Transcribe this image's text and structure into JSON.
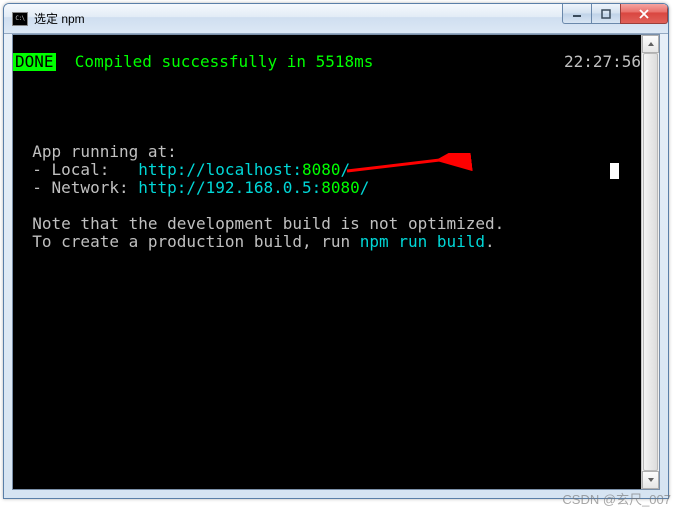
{
  "window": {
    "title": "选定 npm"
  },
  "terminal": {
    "status": {
      "badge": "DONE",
      "message": "Compiled successfully in 5518ms",
      "time": "22:27:56"
    },
    "app_running": "App running at:",
    "local_label": "- Local:   ",
    "local_url_host": "http://localhost:",
    "local_url_port": "8080",
    "local_url_slash": "/",
    "network_label": "- Network: ",
    "network_url_host": "http://192.168.0.5:",
    "network_url_port": "8080",
    "network_url_slash": "/",
    "note1": "Note that the development build is not optimized.",
    "note2_pre": "To create a production build, run ",
    "note2_cmd": "npm run build",
    "note2_post": "."
  },
  "watermark": "CSDN @玄尺_007"
}
